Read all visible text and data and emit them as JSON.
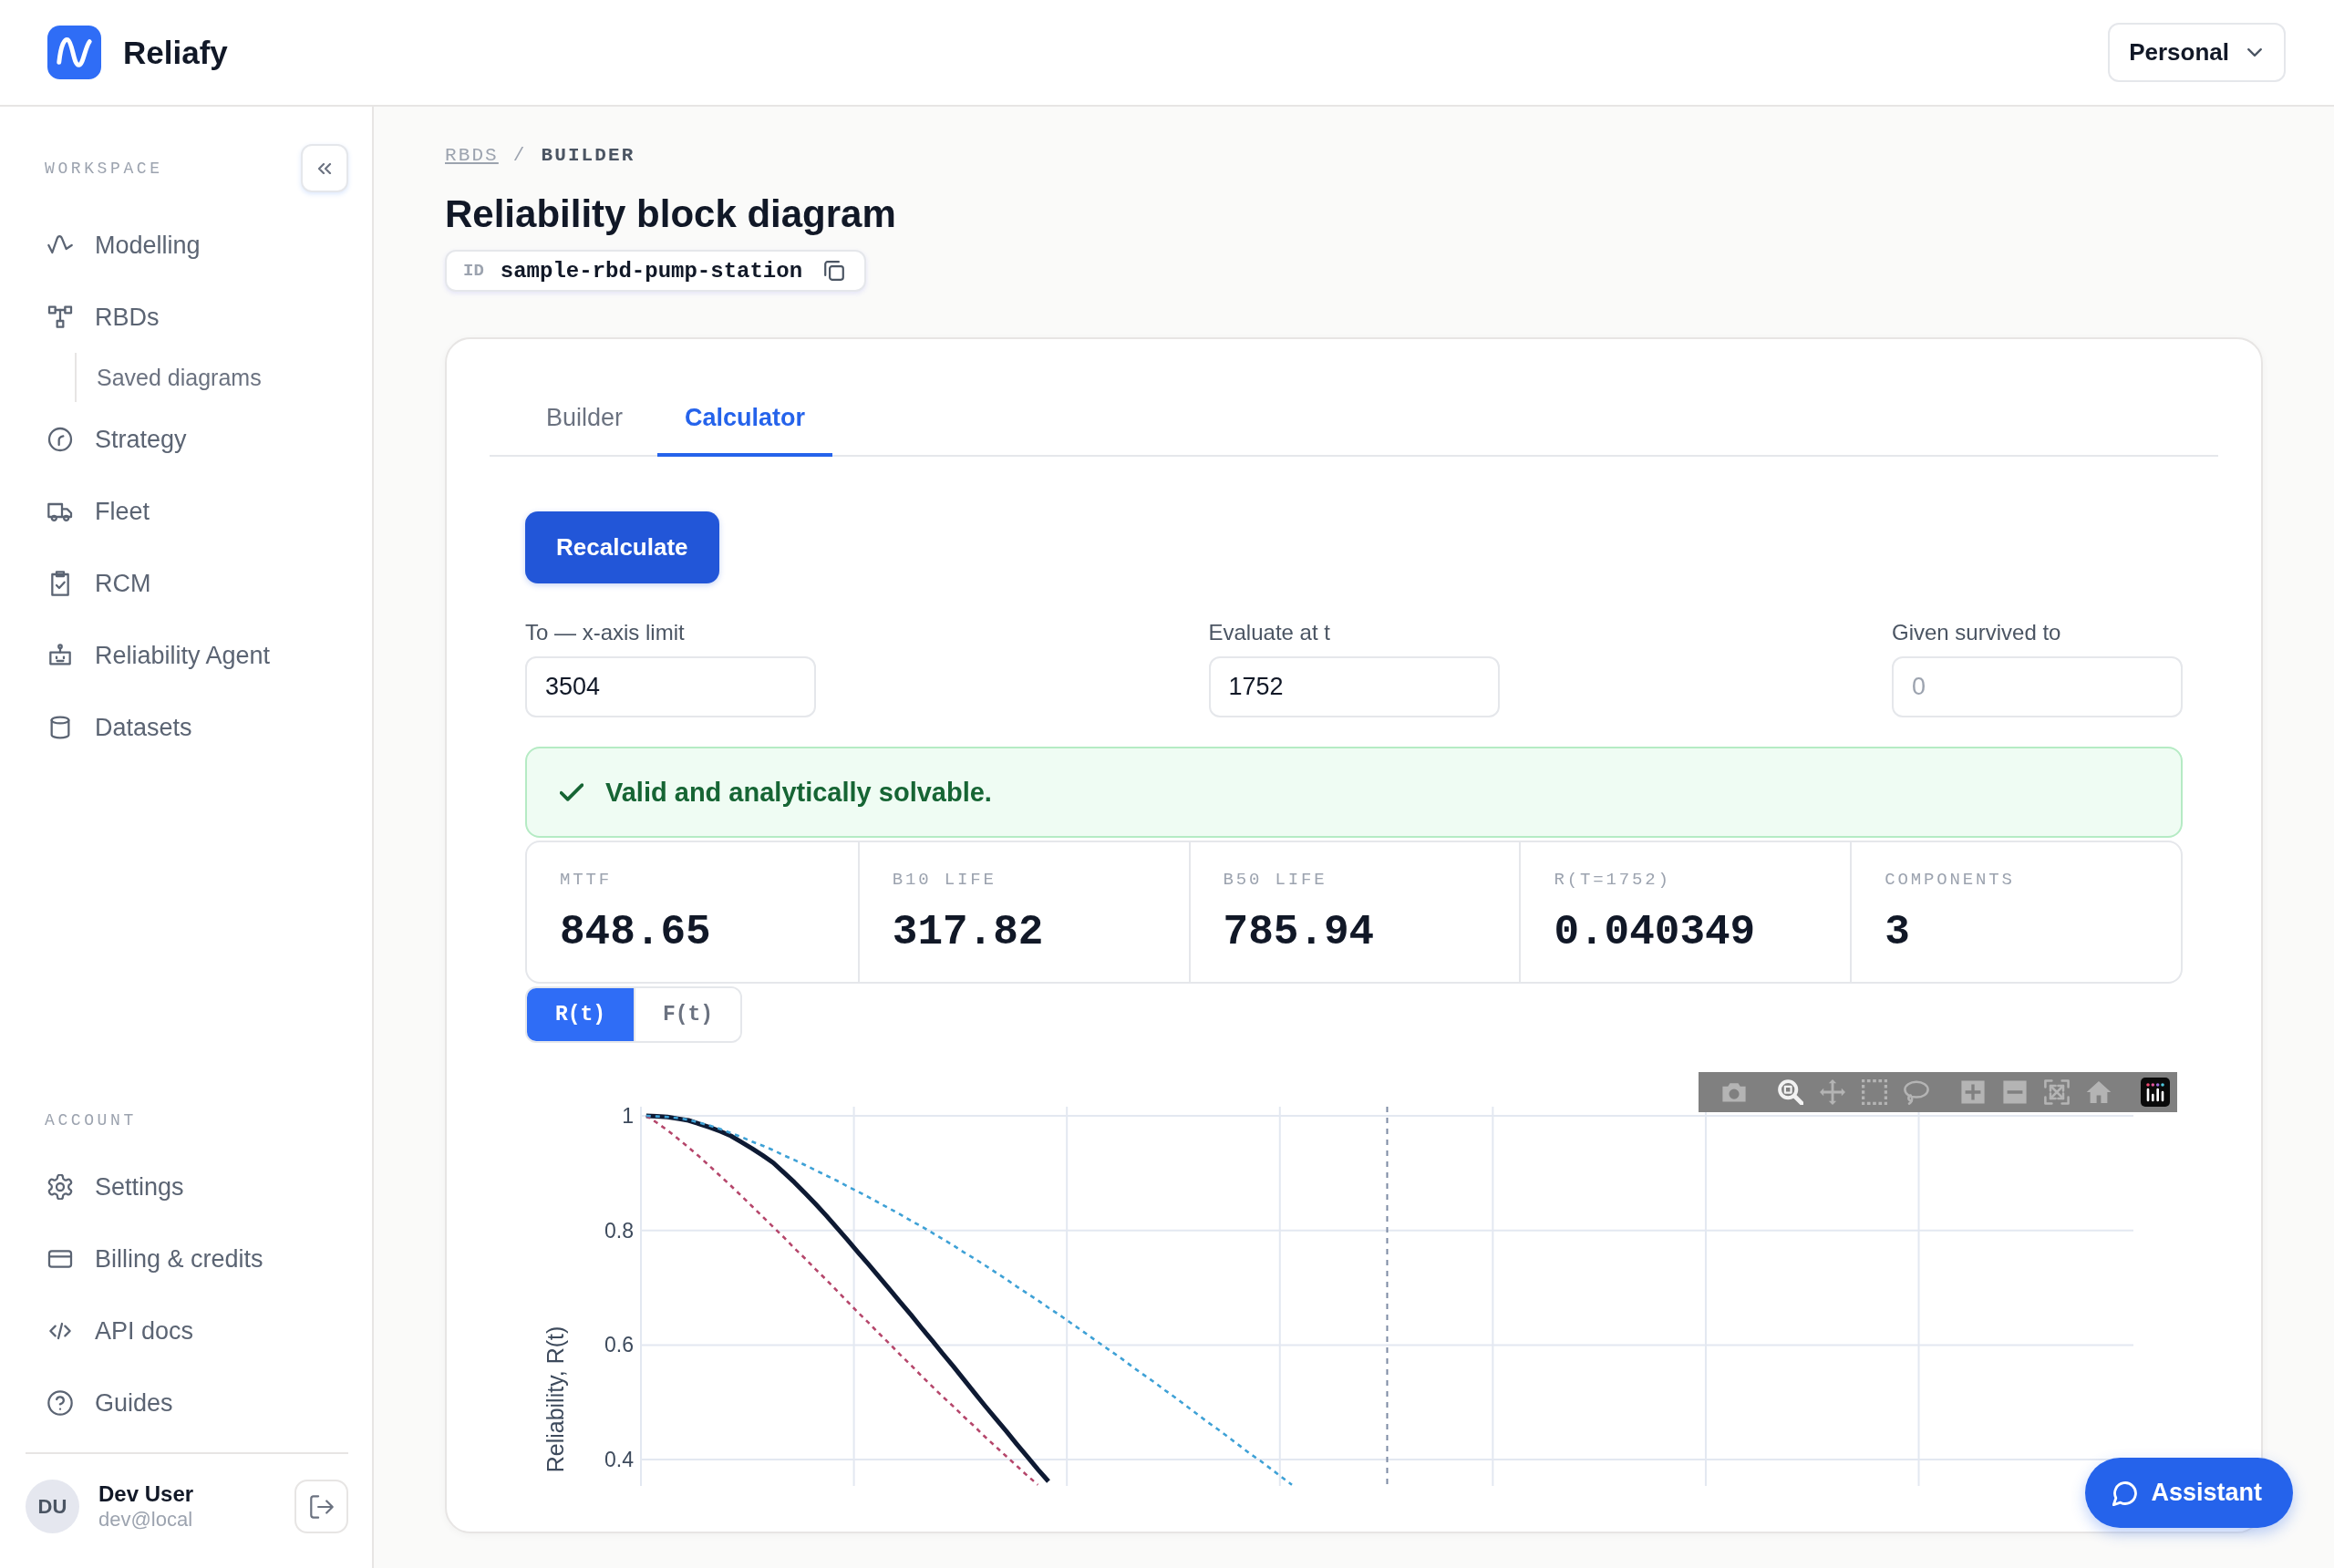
{
  "header": {
    "brand": "Reliafy",
    "account_switcher": "Personal"
  },
  "sidebar": {
    "sections": [
      {
        "title": "WORKSPACE",
        "items": [
          {
            "label": "Modelling"
          },
          {
            "label": "RBDs",
            "children": [
              {
                "label": "Saved diagrams"
              }
            ]
          },
          {
            "label": "Strategy"
          },
          {
            "label": "Fleet"
          },
          {
            "label": "RCM"
          },
          {
            "label": "Reliability Agent"
          },
          {
            "label": "Datasets"
          }
        ]
      },
      {
        "title": "ACCOUNT",
        "items": [
          {
            "label": "Settings"
          },
          {
            "label": "Billing & credits"
          },
          {
            "label": "API docs"
          },
          {
            "label": "Guides"
          }
        ]
      }
    ],
    "user": {
      "initials": "DU",
      "name": "Dev User",
      "email": "dev@local"
    }
  },
  "breadcrumb": {
    "items": [
      {
        "label": "RBDS",
        "kind": "link"
      },
      {
        "label": "BUILDER",
        "kind": "current"
      }
    ],
    "separator": "/"
  },
  "title": "Reliability block diagram",
  "id_chip": {
    "label": "ID",
    "value": "sample-rbd-pump-station"
  },
  "tabs": [
    {
      "label": "Builder",
      "selected": false
    },
    {
      "label": "Calculator",
      "selected": true
    }
  ],
  "calculator": {
    "recalculate_button": "Recalculate",
    "fields": [
      {
        "label": "To — x-axis limit",
        "value": "3504"
      },
      {
        "label": "Evaluate at t",
        "value": "1752"
      },
      {
        "label": "Given survived to",
        "placeholder": "0"
      }
    ],
    "status": {
      "kind": "success",
      "text": "Valid and analytically solvable."
    },
    "metrics": [
      {
        "label": "MTTF",
        "value": "848.65"
      },
      {
        "label": "B10 LIFE",
        "value": "317.82"
      },
      {
        "label": "B50 LIFE",
        "value": "785.94"
      },
      {
        "label": "R(T=1752)",
        "value": "0.040349"
      },
      {
        "label": "COMPONENTS",
        "value": "3"
      }
    ],
    "curve_toggle": [
      {
        "label": "R(t)",
        "selected": true
      },
      {
        "label": "F(t)",
        "selected": false
      }
    ],
    "chart": {
      "modebar": [
        {
          "selected": false
        },
        {
          "selected": true
        },
        {
          "selected": false
        },
        {
          "selected": false
        },
        {
          "selected": false
        },
        {
          "selected": false
        },
        {
          "selected": false
        },
        {
          "selected": false
        },
        {
          "selected": false
        }
      ],
      "chart_data": {
        "type": "line",
        "ylabel": "Reliability, R(t)",
        "categories": [
          null,
          null,
          null,
          null,
          null,
          null,
          null,
          null,
          null,
          null,
          null,
          null,
          null,
          null,
          null,
          null,
          null,
          null,
          null,
          null,
          null,
          null,
          null,
          null,
          null,
          null,
          null,
          null,
          null,
          null,
          null,
          null,
          null,
          null,
          null,
          null,
          null,
          null,
          null,
          null,
          null,
          null,
          null,
          null,
          null,
          null,
          null,
          null,
          null,
          null,
          null,
          null,
          null,
          null,
          null,
          null,
          null,
          null,
          null,
          null,
          null,
          null,
          null,
          null,
          null,
          null,
          null,
          null,
          null,
          null,
          null,
          null,
          null,
          null,
          null,
          null,
          null,
          null,
          null,
          null,
          null,
          null,
          null,
          null,
          null,
          null,
          null,
          null,
          null,
          null,
          null,
          null,
          null,
          null,
          null,
          null,
          null,
          null,
          null,
          null,
          null,
          null,
          null,
          null,
          null,
          null,
          null,
          null,
          null,
          null,
          null,
          null,
          null,
          null,
          null,
          null,
          null,
          null,
          null,
          null,
          null,
          null,
          null,
          null,
          null,
          null,
          null,
          null,
          null,
          null,
          null,
          null,
          null,
          null,
          null,
          null,
          null,
          null,
          null,
          null,
          null
        ],
        "series": [
          {
            "color": "#0e1a33",
            "line_style": "solid",
            "values": [
              1,
              0.999,
              0.998,
              0.995,
              0.992,
              0.986,
              0.98,
              0.973,
              0.965,
              0.954,
              0.943,
              0.931,
              0.918,
              0.901,
              0.884,
              0.865,
              0.846,
              0.826,
              0.805,
              0.784,
              0.762,
              0.741,
              0.719,
              0.697,
              0.675,
              0.653,
              0.63,
              0.608,
              0.585,
              0.563,
              0.54,
              0.517,
              0.494,
              0.472,
              0.45,
              0.427,
              0.405,
              0.383,
              0.362,
              null,
              null,
              null,
              null,
              null,
              null,
              null,
              null,
              null,
              null,
              null,
              null,
              null,
              null,
              null,
              null,
              null,
              null,
              null,
              null,
              null,
              null,
              null,
              null,
              null,
              null,
              null,
              null,
              null,
              null,
              null,
              null,
              null,
              null,
              null,
              null,
              null,
              null,
              null,
              null,
              null,
              null,
              null,
              null,
              null,
              null,
              null,
              null,
              null,
              null,
              null,
              null,
              null,
              null,
              null,
              null,
              null,
              null,
              null,
              null,
              null,
              null,
              null,
              null,
              null,
              null,
              null,
              null,
              null,
              null,
              null,
              null,
              null,
              null,
              null,
              null,
              null,
              null,
              null,
              null,
              null,
              null,
              null,
              null,
              null,
              null,
              null,
              null,
              null,
              null,
              null,
              null,
              null,
              null,
              null,
              null,
              null,
              null,
              null,
              null,
              null,
              null
            ]
          },
          {
            "color": "#b5466b",
            "line_style": "dashed",
            "values": [
              1,
              0.988,
              0.975,
              0.96,
              0.945,
              0.929,
              0.912,
              0.895,
              0.878,
              0.86,
              0.842,
              0.824,
              0.806,
              0.788,
              0.769,
              0.751,
              0.732,
              0.714,
              0.695,
              0.676,
              0.657,
              0.639,
              0.62,
              0.602,
              0.583,
              0.565,
              0.546,
              0.528,
              0.51,
              0.493,
              0.475,
              0.458,
              0.44,
              0.423,
              0.406,
              0.389,
              0.372,
              0.356,
              null,
              null,
              null,
              null,
              null,
              null,
              null,
              null,
              null,
              null,
              null,
              null,
              null,
              null,
              null,
              null,
              null,
              null,
              null,
              null,
              null,
              null,
              null,
              null,
              null,
              null,
              null,
              null,
              null,
              null,
              null,
              null,
              null,
              null,
              null,
              null,
              null,
              null,
              null,
              null,
              null,
              null,
              null,
              null,
              null,
              null,
              null,
              null,
              null,
              null,
              null,
              null,
              null,
              null,
              null,
              null,
              null,
              null,
              null,
              null,
              null,
              null,
              null,
              null,
              null,
              null,
              null,
              null,
              null,
              null,
              null,
              null,
              null,
              null,
              null,
              null,
              null,
              null,
              null,
              null,
              null,
              null,
              null,
              null,
              null,
              null,
              null,
              null,
              null,
              null,
              null,
              null,
              null,
              null,
              null,
              null,
              null,
              null,
              null,
              null,
              null,
              null,
              null
            ]
          },
          {
            "color": "#3ea1d6",
            "line_style": "dashed",
            "values": [
              1,
              0.999,
              0.998,
              0.996,
              0.993,
              0.988,
              0.983,
              0.977,
              0.97,
              0.963,
              0.955,
              0.948,
              0.94,
              0.931,
              0.923,
              0.914,
              0.905,
              0.896,
              0.887,
              0.877,
              0.868,
              0.858,
              0.848,
              0.838,
              0.828,
              0.817,
              0.807,
              0.796,
              0.785,
              0.774,
              0.762,
              0.751,
              0.739,
              0.727,
              0.715,
              0.702,
              0.69,
              0.678,
              0.665,
              0.653,
              0.64,
              0.627,
              0.614,
              0.601,
              0.588,
              0.575,
              0.561,
              0.548,
              0.535,
              0.521,
              0.508,
              0.494,
              0.48,
              0.466,
              0.453,
              0.439,
              0.425,
              0.411,
              0.398,
              0.384,
              0.37,
              0.356,
              null,
              null,
              null,
              null,
              null,
              null,
              null,
              null,
              null,
              null,
              null,
              null,
              null,
              null,
              null,
              null,
              null,
              null,
              null,
              null,
              null,
              null,
              null,
              null,
              null,
              null,
              null,
              null,
              null,
              null,
              null,
              null,
              null,
              null,
              null,
              null,
              null,
              null,
              null,
              null,
              null,
              null,
              null,
              null,
              null,
              null,
              null,
              null,
              null,
              null,
              null,
              null,
              null,
              null,
              null,
              null,
              null,
              null,
              null,
              null,
              null,
              null,
              null,
              null,
              null,
              null,
              null,
              null,
              null,
              null,
              null,
              null,
              null,
              null,
              null,
              null,
              null,
              null,
              null
            ]
          }
        ],
        "ylim": [
          0.354,
          1
        ],
        "yticks": [
          {
            "value": 0.4,
            "label": "0.4"
          },
          {
            "value": 0.6,
            "label": "0.6"
          },
          {
            "value": 0.8,
            "label": "0.8"
          },
          {
            "value": 1,
            "label": "1"
          }
        ],
        "grid": true
      }
    }
  },
  "assistant_button": "Assistant"
}
